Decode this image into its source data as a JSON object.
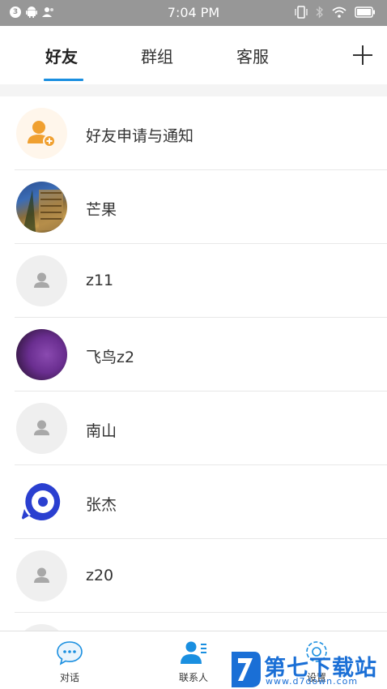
{
  "status_bar": {
    "notification_count": "3",
    "time": "7:04 PM",
    "icons": [
      "android-icon",
      "contacts-icon",
      "vibrate-icon",
      "bluetooth-icon",
      "wifi-icon",
      "battery-icon"
    ]
  },
  "tabs": [
    {
      "label": "好友",
      "active": true
    },
    {
      "label": "群组",
      "active": false
    },
    {
      "label": "客服",
      "active": false
    }
  ],
  "add_icon": "plus-icon",
  "accent_color": "#1a8fe0",
  "list": [
    {
      "label": "好友申请与通知",
      "avatar": "friend-request-icon"
    },
    {
      "label": "芒果",
      "avatar": "photo"
    },
    {
      "label": "z11",
      "avatar": "default-user-icon"
    },
    {
      "label": "飞鸟z2",
      "avatar": "photo"
    },
    {
      "label": "南山",
      "avatar": "default-user-icon"
    },
    {
      "label": "张杰",
      "avatar": "chat-logo"
    },
    {
      "label": "z20",
      "avatar": "default-user-icon"
    }
  ],
  "bottom_nav": [
    {
      "label": "对话",
      "icon": "chat-bubble-icon",
      "color": "#1a8fe0"
    },
    {
      "label": "联系人",
      "icon": "contacts-icon",
      "color": "#1a8fe0",
      "active": true
    },
    {
      "label": "设置",
      "icon": "settings-icon",
      "color": "#1a8fe0"
    }
  ],
  "watermark": {
    "title": "第七下载站",
    "url": "www.d7down.com"
  }
}
